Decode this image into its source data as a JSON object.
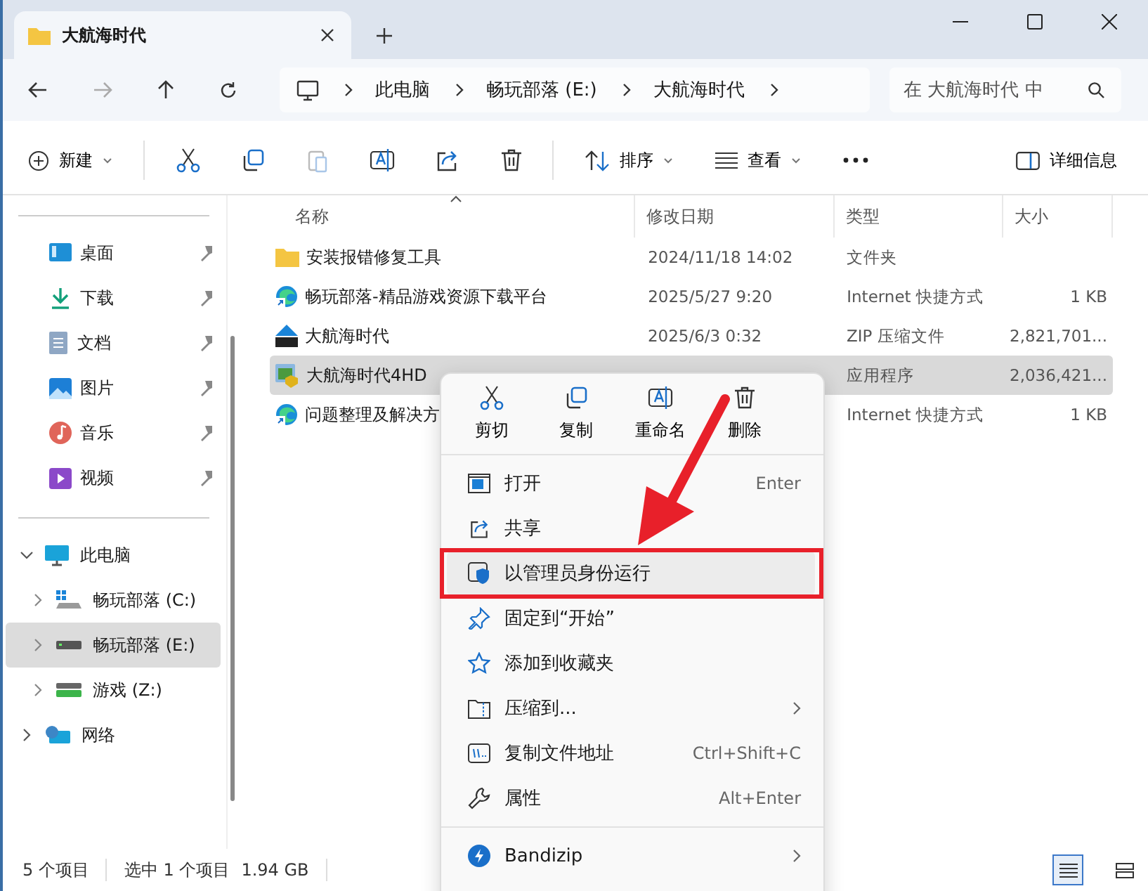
{
  "window": {
    "tab_title": "大航海时代"
  },
  "address": {
    "segments": [
      "此电脑",
      "畅玩部落 (E:)",
      "大航海时代"
    ]
  },
  "search": {
    "placeholder": "在 大航海时代 中"
  },
  "toolbar": {
    "new": "新建",
    "sort": "排序",
    "view": "查看",
    "details": "详细信息"
  },
  "sidebar": {
    "quick_access": [
      {
        "label": "桌面",
        "kind": "desktop",
        "pinned": true
      },
      {
        "label": "下载",
        "kind": "download",
        "pinned": true
      },
      {
        "label": "文档",
        "kind": "document",
        "pinned": true
      },
      {
        "label": "图片",
        "kind": "picture",
        "pinned": true
      },
      {
        "label": "音乐",
        "kind": "music",
        "pinned": true
      },
      {
        "label": "视频",
        "kind": "video",
        "pinned": true
      }
    ],
    "tree": [
      {
        "label": "此电脑",
        "kind": "pc",
        "expanded": true,
        "selected": false,
        "children": [
          {
            "label": "畅玩部落 (C:)",
            "kind": "sysdrive",
            "expanded": false,
            "selected": false
          },
          {
            "label": "畅玩部落 (E:)",
            "kind": "drive",
            "expanded": false,
            "selected": true
          },
          {
            "label": "游戏 (Z:)",
            "kind": "netdrive",
            "expanded": false,
            "selected": false
          }
        ]
      },
      {
        "label": "网络",
        "kind": "network",
        "expanded": false,
        "selected": false
      }
    ]
  },
  "table": {
    "columns": [
      "名称",
      "修改日期",
      "类型",
      "大小"
    ],
    "rows": [
      {
        "name": "安装报错修复工具",
        "modified": "2024/11/18 14:02",
        "type": "文件夹",
        "kind": "folder",
        "selected": false
      },
      {
        "name": "畅玩部落-精品游戏资源下载平台",
        "modified": "2025/5/27 9:20",
        "type": "Internet 快捷方式",
        "size": "1 KB",
        "kind": "link",
        "selected": false
      },
      {
        "name": "大航海时代",
        "modified": "2025/6/3 0:32",
        "type": "ZIP 压缩文件",
        "size": "2,821,701...",
        "kind": "zip",
        "selected": false
      },
      {
        "name": "大航海时代4HD",
        "type": "应用程序",
        "size": "2,036,421...",
        "kind": "app",
        "selected": true
      },
      {
        "name": "问题整理及解决方",
        "type": "Internet 快捷方式",
        "size": "1 KB",
        "kind": "link",
        "selected": false
      }
    ]
  },
  "context_menu": {
    "quick_actions": [
      {
        "label": "剪切",
        "kind": "cut"
      },
      {
        "label": "复制",
        "kind": "copy"
      },
      {
        "label": "重命名",
        "kind": "rename"
      },
      {
        "label": "删除",
        "kind": "delete"
      }
    ],
    "items": [
      {
        "label": "打开",
        "shortcut": "Enter",
        "kind": "open",
        "highlighted": false,
        "submenu": false
      },
      {
        "label": "共享",
        "kind": "share",
        "highlighted": false,
        "submenu": false
      },
      {
        "label": "以管理员身份运行",
        "kind": "admin",
        "highlighted": true,
        "submenu": false
      },
      {
        "label": "固定到“开始”",
        "kind": "pin",
        "highlighted": false,
        "submenu": false
      },
      {
        "label": "添加到收藏夹",
        "kind": "star",
        "highlighted": false,
        "submenu": false
      },
      {
        "label": "压缩到...",
        "kind": "zip",
        "highlighted": false,
        "submenu": true
      },
      {
        "label": "复制文件地址",
        "shortcut": "Ctrl+Shift+C",
        "kind": "path",
        "highlighted": false,
        "submenu": false
      },
      {
        "label": "属性",
        "shortcut": "Alt+Enter",
        "kind": "wrench",
        "highlighted": false,
        "submenu": false
      },
      {
        "label": "Bandizip",
        "kind": "bandizip",
        "highlighted": false,
        "submenu": true,
        "separator_before": true
      }
    ]
  },
  "status_bar": {
    "count": "5 个项目",
    "selection": "选中 1 个项目",
    "size": "1.94 GB",
    "view_modes": [
      {
        "kind": "details",
        "selected": true
      },
      {
        "kind": "tiles",
        "selected": false
      }
    ]
  }
}
